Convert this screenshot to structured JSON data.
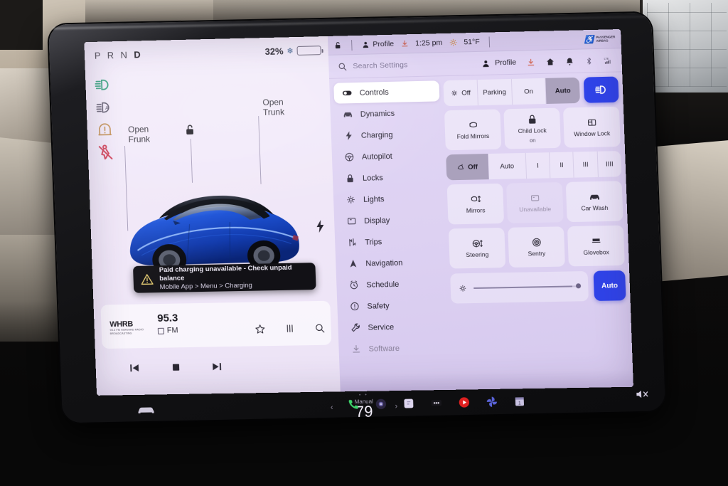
{
  "drive": {
    "gear_indicator": "PRND",
    "gear_active": "D",
    "battery_percent": "32%",
    "snowflake_icon": "snowflake-icon",
    "telltales": [
      {
        "name": "headlight-on-indicator",
        "color": "#2f9e7a"
      },
      {
        "name": "auto-highbeam-indicator",
        "color": "#5a5468"
      },
      {
        "name": "tire-pressure-warning",
        "color": "#c08a4a"
      },
      {
        "name": "seatbelt-warning",
        "color": "#d03a52"
      }
    ],
    "frunk_label_line1": "Open",
    "frunk_label_line2": "Frunk",
    "trunk_label_line1": "Open",
    "trunk_label_line2": "Trunk",
    "unlock_icon": "unlock-icon",
    "charge_port_icon": "bolt-icon"
  },
  "alert": {
    "icon": "warning-triangle-icon",
    "title": "Paid charging unavailable - Check unpaid balance",
    "subtitle": "Mobile App > Menu > Charging"
  },
  "media": {
    "station_logo": "WHRB",
    "station_logo_sub": "95.3 FM  HARVARD RADIO BROADCASTING",
    "frequency": "95.3",
    "band": "FM",
    "icons": [
      "favorite-star-icon",
      "equalizer-icon",
      "search-icon"
    ],
    "transport": [
      "previous-track-button",
      "stop-button",
      "next-track-button"
    ]
  },
  "topbar": {
    "lock_icon": "unlock-icon",
    "profile_icon": "profile-icon",
    "profile_label": "Profile",
    "download_icon": "download-icon",
    "time": "1:25 pm",
    "weather_icon": "sun-icon",
    "temperature": "51°F",
    "airbag_symbol": "passenger-airbag-icon",
    "airbag_line1": "PASSENGER",
    "airbag_line2": "AIRBAG"
  },
  "search": {
    "icon": "search-icon",
    "placeholder": "Search Settings",
    "profile_icon": "profile-icon",
    "profile_label": "Profile",
    "right_icons": [
      "download-icon",
      "home-icon",
      "bell-icon",
      "bluetooth-icon",
      "lte-signal-icon"
    ]
  },
  "sidebar": {
    "items": [
      {
        "label": "Controls",
        "icon": "toggle-icon",
        "active": true
      },
      {
        "label": "Dynamics",
        "icon": "car-icon",
        "active": false
      },
      {
        "label": "Charging",
        "icon": "bolt-icon",
        "active": false
      },
      {
        "label": "Autopilot",
        "icon": "steering-icon",
        "active": false
      },
      {
        "label": "Locks",
        "icon": "lock-icon",
        "active": false
      },
      {
        "label": "Lights",
        "icon": "light-icon",
        "active": false
      },
      {
        "label": "Display",
        "icon": "display-icon",
        "active": false
      },
      {
        "label": "Trips",
        "icon": "trips-icon",
        "active": false
      },
      {
        "label": "Navigation",
        "icon": "navigation-icon",
        "active": false
      },
      {
        "label": "Schedule",
        "icon": "clock-icon",
        "active": false
      },
      {
        "label": "Safety",
        "icon": "safety-icon",
        "active": false
      },
      {
        "label": "Service",
        "icon": "wrench-icon",
        "active": false
      },
      {
        "label": "Software",
        "icon": "download-icon",
        "active": false
      }
    ]
  },
  "controls": {
    "headlights": {
      "options": [
        "Off",
        "Parking",
        "On",
        "Auto"
      ],
      "selected": "Auto",
      "off_icon": "light-off-icon",
      "highbeam_button_icon": "highbeam-icon",
      "highbeam_button_color": "#2f43e8"
    },
    "mirror_row": [
      {
        "label": "Fold Mirrors",
        "sub": "",
        "icon": "mirror-icon",
        "disabled": false
      },
      {
        "label": "Child Lock",
        "sub": "on",
        "icon": "child-lock-icon",
        "disabled": false
      },
      {
        "label": "Window Lock",
        "sub": "",
        "icon": "window-lock-icon",
        "disabled": false
      }
    ],
    "wipers": {
      "options": [
        "Off",
        "Auto",
        "I",
        "II",
        "III",
        "IIII"
      ],
      "selected": "Off",
      "off_icon": "wiper-icon"
    },
    "adjust_row": [
      {
        "label": "Mirrors",
        "icon": "mirror-adjust-icon",
        "disabled": false
      },
      {
        "label": "Unavailable",
        "icon": "unavailable-icon",
        "disabled": true
      },
      {
        "label": "Car Wash",
        "icon": "car-wash-icon",
        "disabled": false
      }
    ],
    "feature_row": [
      {
        "label": "Steering",
        "icon": "steering-adjust-icon",
        "disabled": false
      },
      {
        "label": "Sentry",
        "icon": "sentry-icon",
        "disabled": false
      },
      {
        "label": "Glovebox",
        "icon": "glovebox-icon",
        "disabled": false
      }
    ],
    "brightness": {
      "icon": "brightness-sun-icon",
      "value_percent": 92,
      "auto_label": "Auto",
      "auto_color": "#2f43e8"
    }
  },
  "climate": {
    "car_icon": "car-front-icon",
    "mode": "Manual",
    "temperature": "79",
    "left_chevron": "‹",
    "right_chevron": "›"
  },
  "taskbar": {
    "items": [
      {
        "name": "phone-icon",
        "color": "#3dd36a"
      },
      {
        "name": "dashcam-icon",
        "color": "#2a2440"
      },
      {
        "name": "card-icon",
        "color": "#ded6ef"
      },
      {
        "name": "more-dots-icon",
        "color": "#17161b"
      },
      {
        "name": "youtube-icon",
        "color": "#e02020"
      },
      {
        "name": "pinwheel-icon",
        "color": "#5a63d8"
      },
      {
        "name": "calendar-icon",
        "color": "#c9c2e2"
      }
    ],
    "mute_icon": "volume-mute-icon"
  }
}
